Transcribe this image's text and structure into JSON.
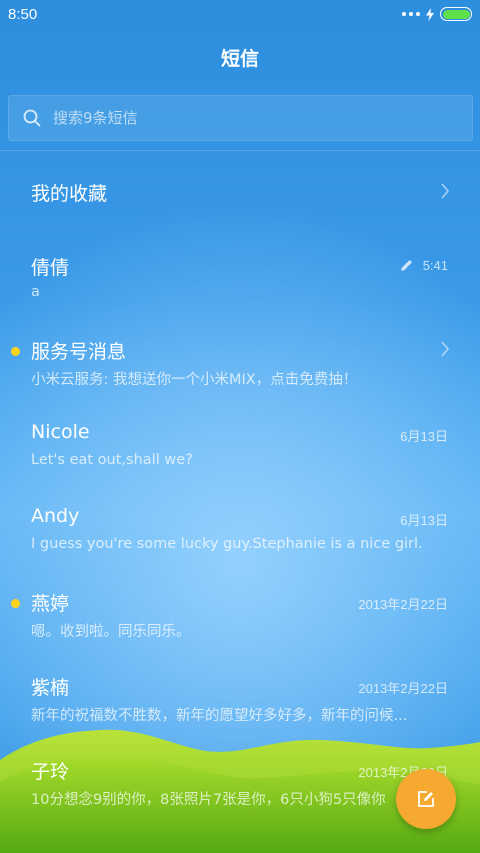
{
  "status_bar": {
    "time": "8:50"
  },
  "header": {
    "title": "短信"
  },
  "search": {
    "placeholder": "搜索9条短信"
  },
  "favorites": {
    "label": "我的收藏"
  },
  "conversations": [
    {
      "name": "倩倩",
      "preview": "a",
      "date": "5:41",
      "draft": true,
      "unread": false,
      "chevron": false
    },
    {
      "name": "服务号消息",
      "preview": "小米云服务: 我想送你一个小米MIX，点击免费抽！",
      "date": "",
      "draft": false,
      "unread": true,
      "chevron": true
    },
    {
      "name": "Nicole",
      "preview": "Let's eat out,shall we?",
      "date": "6月13日",
      "draft": false,
      "unread": false,
      "chevron": false
    },
    {
      "name": "Andy",
      "preview": "I guess you're some lucky guy.Stephanie is a nice girl.",
      "date": "6月13日",
      "draft": false,
      "unread": false,
      "chevron": false
    },
    {
      "name": "燕婷",
      "preview": "嗯。收到啦。同乐同乐。",
      "date": "2013年2月22日",
      "draft": false,
      "unread": true,
      "chevron": false
    },
    {
      "name": "紫楠",
      "preview": "新年的祝福数不胜数，新年的愿望好多好多，新年的问候...",
      "date": "2013年2月22日",
      "draft": false,
      "unread": false,
      "chevron": false
    },
    {
      "name": "子玲",
      "preview": "10分想念9别的你，8张照片7张是你，6只小狗5只像你",
      "date": "2013年2月22日",
      "draft": false,
      "unread": false,
      "chevron": false
    }
  ],
  "colors": {
    "accent": "#f6a930",
    "unread_dot": "#ffd21e",
    "battery": "#5fe048"
  },
  "icons": {
    "search": "search-icon",
    "compose": "compose-icon",
    "chevron": "chevron-right-icon",
    "draft": "pencil-icon"
  }
}
